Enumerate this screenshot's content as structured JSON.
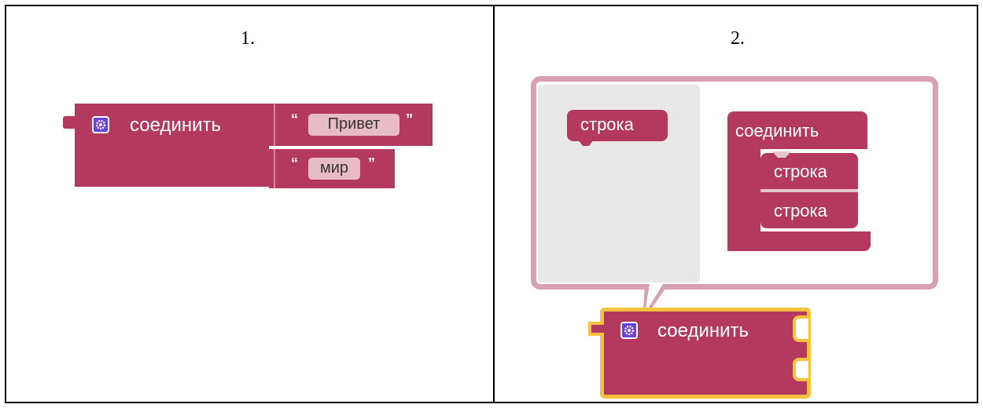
{
  "panel1": {
    "number": "1.",
    "block": {
      "label": "соединить",
      "inputs": [
        {
          "open_quote": "“",
          "text": "Привет",
          "close_quote": "”"
        },
        {
          "open_quote": "“",
          "text": "мир",
          "close_quote": "”"
        }
      ]
    }
  },
  "panel2": {
    "number": "2.",
    "mutator": {
      "palette_item": "строка",
      "container_label": "соединить",
      "items": [
        "строка",
        "строка"
      ]
    },
    "block": {
      "label": "соединить"
    }
  },
  "colors": {
    "block": "#b4395f",
    "gear": "#6b3fd8",
    "field": "#e7bcc6",
    "mutator_border": "#d7a1b1",
    "mutator_bg": "#e8e8e8",
    "selection": "#f6c23e"
  }
}
